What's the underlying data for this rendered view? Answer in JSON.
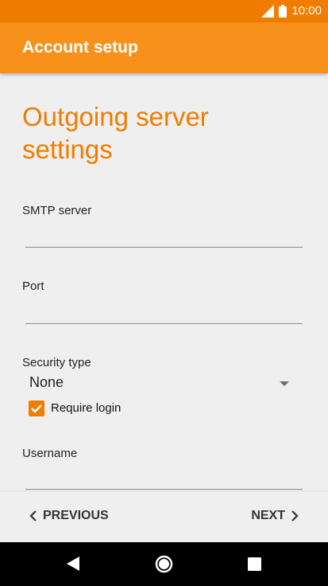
{
  "status_bar": {
    "time": "10:00"
  },
  "app_bar": {
    "title": "Account setup"
  },
  "page": {
    "title": "Outgoing server settings",
    "fields": {
      "smtp_server": {
        "label": "SMTP server",
        "value": ""
      },
      "port": {
        "label": "Port",
        "value": ""
      },
      "security_type": {
        "label": "Security type",
        "value": "None"
      },
      "require_login": {
        "label": "Require login",
        "checked": true
      },
      "username": {
        "label": "Username",
        "value": ""
      }
    }
  },
  "bottom_nav": {
    "previous": "PREVIOUS",
    "next": "NEXT"
  },
  "colors": {
    "accent": "#f07c00",
    "app_bar": "#f8911c",
    "status_bar": "#f07c00"
  },
  "icons": [
    "signal-icon",
    "battery-icon",
    "chevron-left-icon",
    "chevron-right-icon",
    "check-icon",
    "back-icon",
    "home-icon",
    "recents-icon"
  ]
}
